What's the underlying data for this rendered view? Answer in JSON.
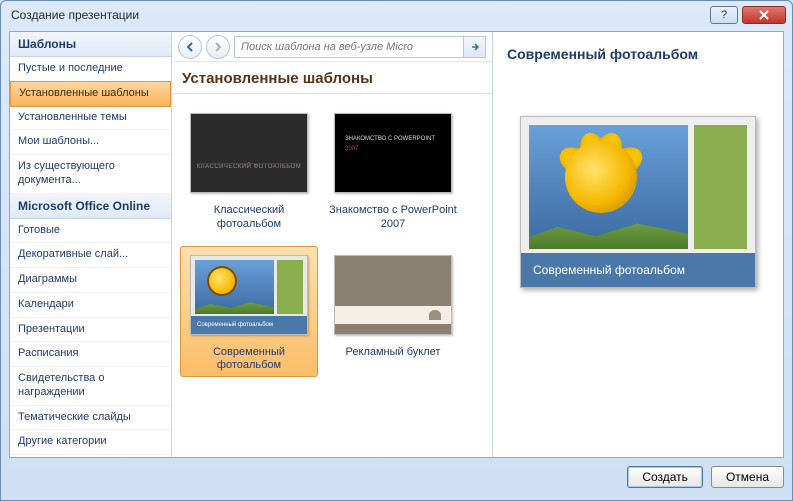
{
  "window": {
    "title": "Создание презентации"
  },
  "sidebar": {
    "head1": "Шаблоны",
    "items1": [
      "Пустые и последние",
      "Установленные шаблоны",
      "Установленные темы",
      "Мои шаблоны...",
      "Из существующего документа..."
    ],
    "head2": "Microsoft Office Online",
    "items2": [
      "Готовые",
      "Декоративные слай...",
      "Диаграммы",
      "Календари",
      "Презентации",
      "Расписания",
      "Свидетельства о награждении",
      "Тематические слайды",
      "Другие категории"
    ],
    "active_index": 1
  },
  "toolbar": {
    "search_placeholder": "Поиск шаблона на веб-узле Micro"
  },
  "center": {
    "heading": "Установленные шаблоны",
    "templates": [
      {
        "id": "classic",
        "label": "Классический фотоальбом"
      },
      {
        "id": "ppt2007",
        "label": "Знакомство с PowerPoint 2007"
      },
      {
        "id": "modern",
        "label": "Современный фотоальбом",
        "selected": true
      },
      {
        "id": "brochure",
        "label": "Рекламный буклет"
      }
    ]
  },
  "preview": {
    "title": "Современный фотоальбом",
    "slide_caption": "Современный фотоальбом"
  },
  "thumbs": {
    "classic_text": "КЛАССИЧЕСКИЙ ФОТОАЛЬБОМ",
    "ppt_line1": "ЗНАКОМСТВО С POWERPOINT",
    "ppt_line2": "2007",
    "modern_bar": "Современный фотоальбом"
  },
  "footer": {
    "create": "Создать",
    "cancel": "Отмена"
  }
}
